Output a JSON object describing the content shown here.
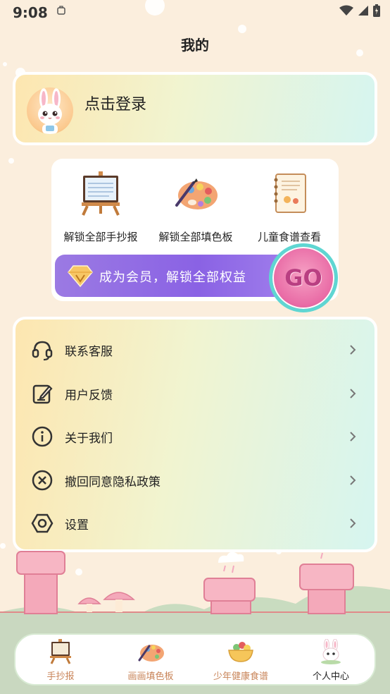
{
  "status_bar": {
    "time": "9:08"
  },
  "page_title": "我的",
  "login": {
    "label": "点击登录"
  },
  "member": {
    "perks": [
      {
        "label": "解锁全部手抄报",
        "icon": "easel-icon"
      },
      {
        "label": "解锁全部填色板",
        "icon": "palette-icon"
      },
      {
        "label": "儿童食谱查看",
        "icon": "recipe-notebook-icon"
      }
    ],
    "banner_text": "成为会员，解锁全部权益",
    "go_label": "GO"
  },
  "menu": {
    "items": [
      {
        "label": "联系客服",
        "icon": "headset-icon"
      },
      {
        "label": "用户反馈",
        "icon": "edit-icon"
      },
      {
        "label": "关于我们",
        "icon": "info-icon"
      },
      {
        "label": "撤回同意隐私政策",
        "icon": "close-circle-icon"
      },
      {
        "label": "设置",
        "icon": "settings-icon"
      }
    ]
  },
  "tabs": [
    {
      "label": "手抄报",
      "icon": "easel-icon",
      "active": false
    },
    {
      "label": "画画填色板",
      "icon": "palette-icon",
      "active": false
    },
    {
      "label": "少年健康食谱",
      "icon": "food-bowl-icon",
      "active": false
    },
    {
      "label": "个人中心",
      "icon": "bunny-icon",
      "active": true
    }
  ],
  "colors": {
    "background": "#fbeedd",
    "vip_purple": "#8a62e4",
    "tab_label": "#c9855a",
    "accent_pink": "#e96ca6"
  }
}
